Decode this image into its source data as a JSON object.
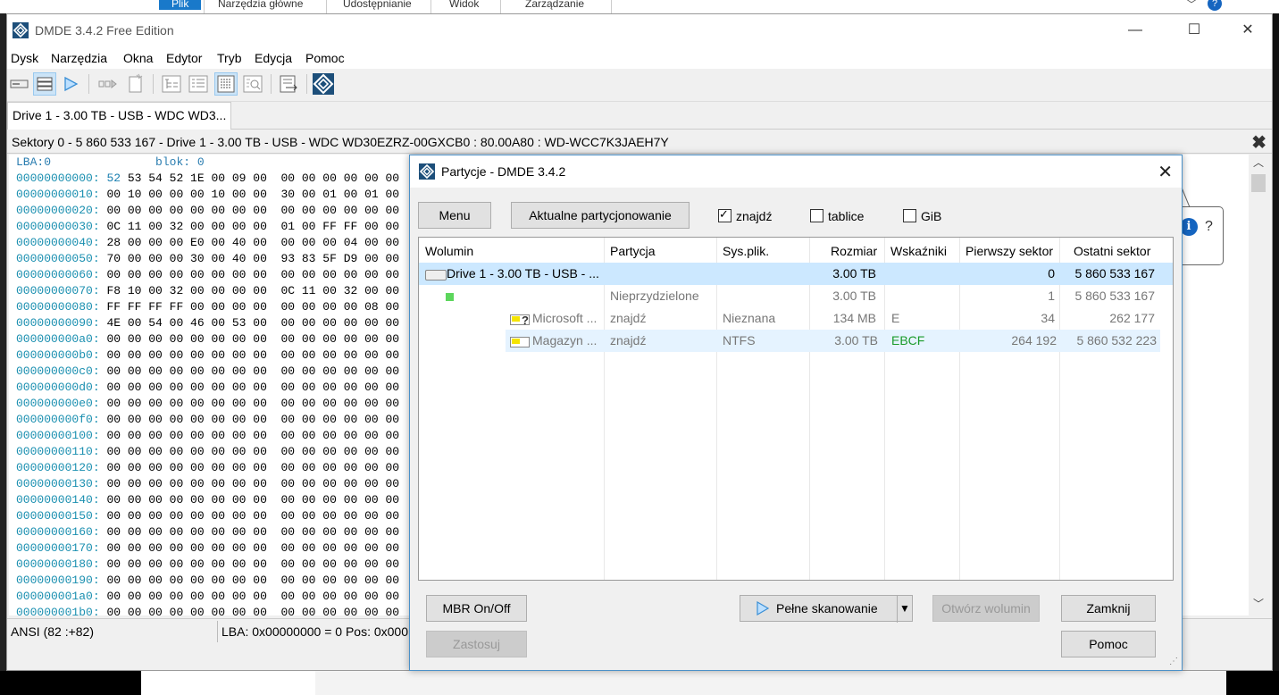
{
  "ribbon": {
    "tabs": [
      "Plik",
      "Narzędzia główne",
      "Udostępnianie",
      "Widok",
      "Zarządzanie"
    ],
    "selected": "Plik"
  },
  "app": {
    "title": "DMDE 3.4.2 Free Edition",
    "menu": [
      "Dysk",
      "Narzędzia",
      "Okna",
      "Edytor",
      "Tryb",
      "Edycja",
      "Pomoc"
    ],
    "drive_tab": "Drive 1 - 3.00 TB - USB - WDC WD3...",
    "panel_title": "Sektory 0 - 5 860 533 167 - Drive 1 - 3.00 TB - USB - WDC WD30EZRZ-00GXCB0 : 80.00A80 : WD-WCC7K3JAEH7Y",
    "panel_close": "✖"
  },
  "hex": {
    "header_lba": "LBA:0",
    "header_blok": "blok: 0",
    "rows": [
      {
        "addr": "00000000000:",
        "first": "52",
        "bytes": " 53 54 52 1E 00 09 00  00 00 00 00 00 00"
      },
      {
        "addr": "00000000010:",
        "first": "00",
        "bytes": " 10 00 00 00 10 00 00  30 00 01 00 01 00"
      },
      {
        "addr": "00000000020:",
        "first": "00",
        "bytes": " 00 00 00 00 00 00 00  00 00 00 00 00 00"
      },
      {
        "addr": "00000000030:",
        "first": "0C",
        "bytes": " 11 00 32 00 00 00 00  01 00 FF FF 00 00"
      },
      {
        "addr": "00000000040:",
        "first": "28",
        "bytes": " 00 00 00 E0 00 40 00  00 00 00 04 00 00"
      },
      {
        "addr": "00000000050:",
        "first": "70",
        "bytes": " 00 00 00 30 00 40 00  93 83 5F D9 00 00"
      },
      {
        "addr": "00000000060:",
        "first": "00",
        "bytes": " 00 00 00 00 00 00 00  00 00 00 00 00 00"
      },
      {
        "addr": "00000000070:",
        "first": "F8",
        "bytes": " 10 00 32 00 00 00 00  0C 11 00 32 00 00"
      },
      {
        "addr": "00000000080:",
        "first": "FF",
        "bytes": " FF FF FF 00 00 00 00  00 00 00 00 08 00"
      },
      {
        "addr": "00000000090:",
        "first": "4E",
        "bytes": " 00 54 00 46 00 53 00  00 00 00 00 00 00"
      },
      {
        "addr": "000000000a0:",
        "first": "00",
        "bytes": " 00 00 00 00 00 00 00  00 00 00 00 00 00"
      },
      {
        "addr": "000000000b0:",
        "first": "00",
        "bytes": " 00 00 00 00 00 00 00  00 00 00 00 00 00"
      },
      {
        "addr": "000000000c0:",
        "first": "00",
        "bytes": " 00 00 00 00 00 00 00  00 00 00 00 00 00"
      },
      {
        "addr": "000000000d0:",
        "first": "00",
        "bytes": " 00 00 00 00 00 00 00  00 00 00 00 00 00"
      },
      {
        "addr": "000000000e0:",
        "first": "00",
        "bytes": " 00 00 00 00 00 00 00  00 00 00 00 00 00"
      },
      {
        "addr": "000000000f0:",
        "first": "00",
        "bytes": " 00 00 00 00 00 00 00  00 00 00 00 00 00"
      },
      {
        "addr": "00000000100:",
        "first": "00",
        "bytes": " 00 00 00 00 00 00 00  00 00 00 00 00 00"
      },
      {
        "addr": "00000000110:",
        "first": "00",
        "bytes": " 00 00 00 00 00 00 00  00 00 00 00 00 00"
      },
      {
        "addr": "00000000120:",
        "first": "00",
        "bytes": " 00 00 00 00 00 00 00  00 00 00 00 00 00"
      },
      {
        "addr": "00000000130:",
        "first": "00",
        "bytes": " 00 00 00 00 00 00 00  00 00 00 00 00 00"
      },
      {
        "addr": "00000000140:",
        "first": "00",
        "bytes": " 00 00 00 00 00 00 00  00 00 00 00 00 00"
      },
      {
        "addr": "00000000150:",
        "first": "00",
        "bytes": " 00 00 00 00 00 00 00  00 00 00 00 00 00"
      },
      {
        "addr": "00000000160:",
        "first": "00",
        "bytes": " 00 00 00 00 00 00 00  00 00 00 00 00 00"
      },
      {
        "addr": "00000000170:",
        "first": "00",
        "bytes": " 00 00 00 00 00 00 00  00 00 00 00 00 00"
      },
      {
        "addr": "00000000180:",
        "first": "00",
        "bytes": " 00 00 00 00 00 00 00  00 00 00 00 00 00"
      },
      {
        "addr": "00000000190:",
        "first": "00",
        "bytes": " 00 00 00 00 00 00 00  00 00 00 00 00 00"
      },
      {
        "addr": "000000001a0:",
        "first": "00",
        "bytes": " 00 00 00 00 00 00 00  00 00 00 00 00 00"
      },
      {
        "addr": "000000001b0:",
        "first": "00",
        "bytes": " 00 00 00 00 00 00 00  00 00 00 00 00 00"
      }
    ]
  },
  "status": {
    "encoding": "ANSI (82 :+82)",
    "position": "LBA: 0x00000000 = 0  Pos: 0x000"
  },
  "dialog": {
    "title": "Partycje - DMDE 3.4.2",
    "menu_button": "Menu",
    "current_partitioning_button": "Aktualne partycjonowanie",
    "checkboxes": [
      {
        "label": "znajdź",
        "checked": true
      },
      {
        "label": "tablice",
        "checked": false
      },
      {
        "label": "GiB",
        "checked": false
      }
    ],
    "columns": [
      "Wolumin",
      "Partycja",
      "Sys.plik.",
      "Rozmiar",
      "Wskaźniki",
      "Pierwszy sektor",
      "Ostatni sektor"
    ],
    "rows": [
      {
        "volume": "Drive 1 - 3.00 TB - USB - ...",
        "partition": "",
        "fs": "",
        "size": "3.00 TB",
        "flags": "",
        "first": "0",
        "last": "5 860 533 167",
        "icon": "drive-icon"
      },
      {
        "volume": "",
        "partition": "Nieprzydzielone",
        "fs": "",
        "size": "3.00 TB",
        "flags": "",
        "first": "1",
        "last": "5 860 533 167",
        "icon": "unallocated-icon"
      },
      {
        "volume": "Microsoft ...",
        "partition": "znajdź",
        "fs": "Nieznana",
        "size": "134 MB",
        "flags": "E",
        "first": "34",
        "last": "262 177",
        "icon": "partition-unknown-icon"
      },
      {
        "volume": "Magazyn ...",
        "partition": "znajdź",
        "fs": "NTFS",
        "size": "3.00 TB",
        "flags": "EBCF",
        "first": "264 192",
        "last": "5 860 532 223",
        "icon": "partition-icon"
      }
    ],
    "buttons": {
      "mbr": "MBR On/Off",
      "apply": "Zastosuj",
      "full_scan": "Pełne skanowanie",
      "open_volume": "Otwórz wolumin",
      "close": "Zamknij",
      "help": "Pomoc"
    }
  },
  "tooltip": {
    "question": "?",
    "info": "i"
  },
  "colors": {
    "accent": "#1979ca",
    "flags_green": "#1a9b2a",
    "selected_row": "#cce8ff",
    "alt_row": "#e5f3ff"
  }
}
